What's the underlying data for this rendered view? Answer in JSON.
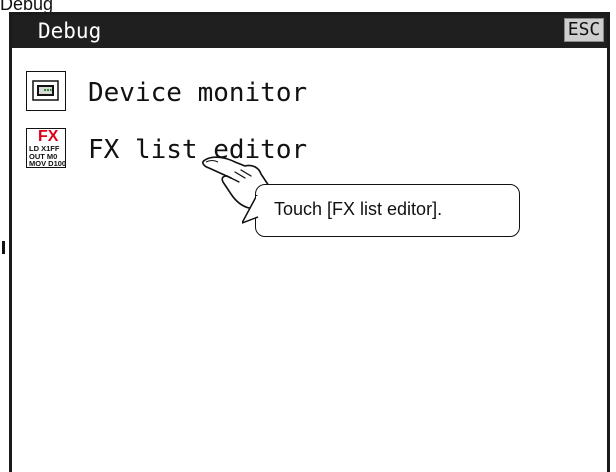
{
  "document_label": "Debug",
  "window": {
    "title": "Debug",
    "esc_label": "ESC"
  },
  "menu": {
    "items": [
      {
        "label": "Device monitor",
        "icon": "device-monitor-icon"
      },
      {
        "label": "FX list editor",
        "icon": "fx-list-editor-icon",
        "icon_text": {
          "title": "FX",
          "line1": "LD X1FF",
          "line2": "OUT M0",
          "line3": "MOV D100"
        }
      }
    ]
  },
  "callout": {
    "text": "Touch [FX list editor]."
  },
  "colors": {
    "title_bar": "#1f1f1f",
    "esc_button": "#cfcfcf",
    "fx_red": "#e0001b"
  }
}
